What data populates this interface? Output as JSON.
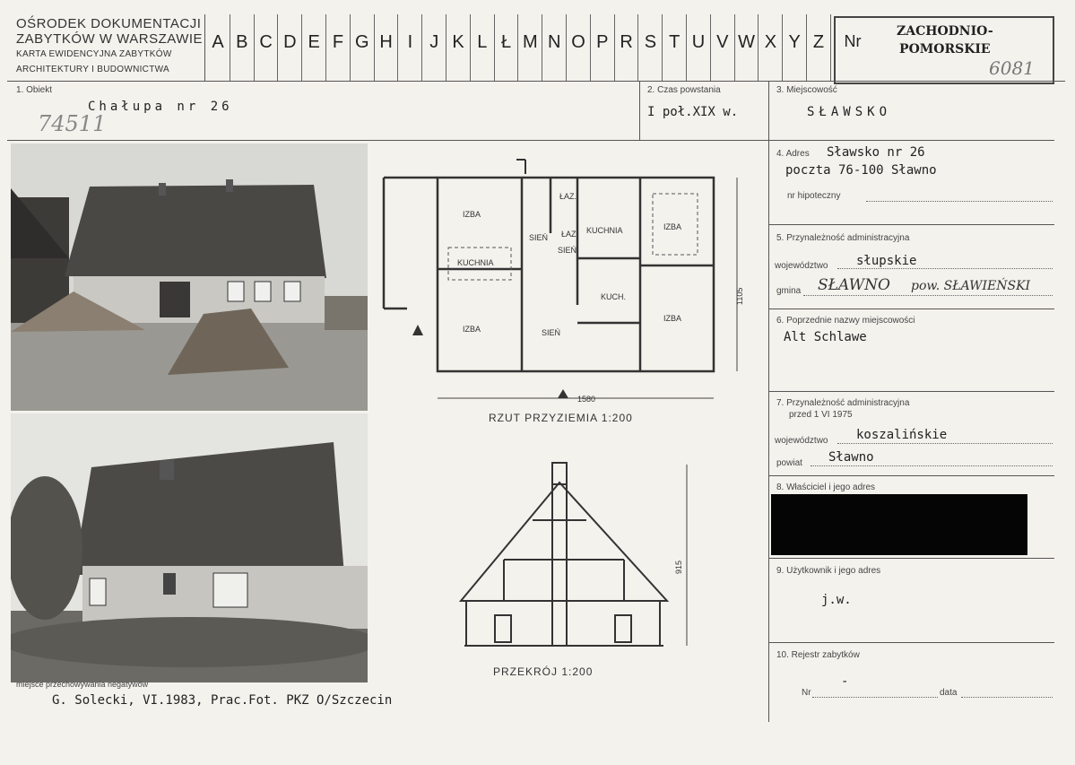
{
  "institution": {
    "line1": "OŚRODEK DOKUMENTACJI",
    "line2": "ZABYTKÓW W WARSZAWIE",
    "line3": "KARTA EWIDENCYJNA ZABYTKÓW",
    "line4": "ARCHITEKTURY I BUDOWNICTWA"
  },
  "alphabet": [
    "A",
    "B",
    "C",
    "D",
    "E",
    "F",
    "G",
    "H",
    "I",
    "J",
    "K",
    "L",
    "Ł",
    "M",
    "N",
    "O",
    "P",
    "R",
    "S",
    "T",
    "U",
    "V",
    "W",
    "X",
    "Y",
    "Z"
  ],
  "nr_label": "Nr",
  "region": {
    "line1": "ZACHODNIO-",
    "line2": "POMORSKIE",
    "number": "6081"
  },
  "fields": {
    "f1_label": "1. Obiekt",
    "f1_value": "Chałupa nr 26",
    "f1_hand": "74511",
    "f2_label": "2. Czas powstania",
    "f2_value": "I poł.XIX w.",
    "f3_label": "3. Miejscowość",
    "f3_value": "SŁAWSKO",
    "f4_label": "4. Adres",
    "f4_value1": "Sławsko nr 26",
    "f4_value2": "poczta 76-100 Sławno",
    "f4_sub": "nr hipoteczny",
    "f5_label": "5. Przynależność administracyjna",
    "f5_woj_label": "województwo",
    "f5_woj": "słupskie",
    "f5_gmina_label": "gmina",
    "f5_gmina": "SŁAWNO",
    "f5_gmina_extra": "pow. SŁAWIEŃSKI",
    "f6_label": "6. Poprzednie nazwy miejscowości",
    "f6_value": "Alt Schlawe",
    "f7_label1": "7. Przynależność administracyjna",
    "f7_label2": "przed 1 VI 1975",
    "f7_woj_label": "województwo",
    "f7_woj": "koszalińskie",
    "f7_pow_label": "powiat",
    "f7_pow": "Sławno",
    "f8_label": "8. Właściciel i jego adres",
    "f9_label": "9. Użytkownik i jego adres",
    "f9_value": "j.w.",
    "f10_label": "10. Rejestr zabytków",
    "f10_nr": "Nr",
    "f10_dash": "-",
    "f10_data": "data"
  },
  "plan": {
    "title": "RZUT PRZYZIEMIA 1:200",
    "rooms": [
      "IZBA",
      "KUCHNIA",
      "ŁAZ.",
      "SIEŃ",
      "ŁAZ",
      "SIEŃ",
      "KUCHNIA",
      "IZBA",
      "IZBA",
      "SIEŃ",
      "KUCH.",
      "IZBA"
    ],
    "dim_width": "1580",
    "dim_depth": "1105"
  },
  "section": {
    "title": "PRZEKRÓJ 1:200",
    "dim_height": "915"
  },
  "footer": {
    "negatives": "miejsce przechowywania negatywów",
    "credit": "G. Solecki, VI.1983, Prac.Fot. PKZ O/Szczecin"
  }
}
